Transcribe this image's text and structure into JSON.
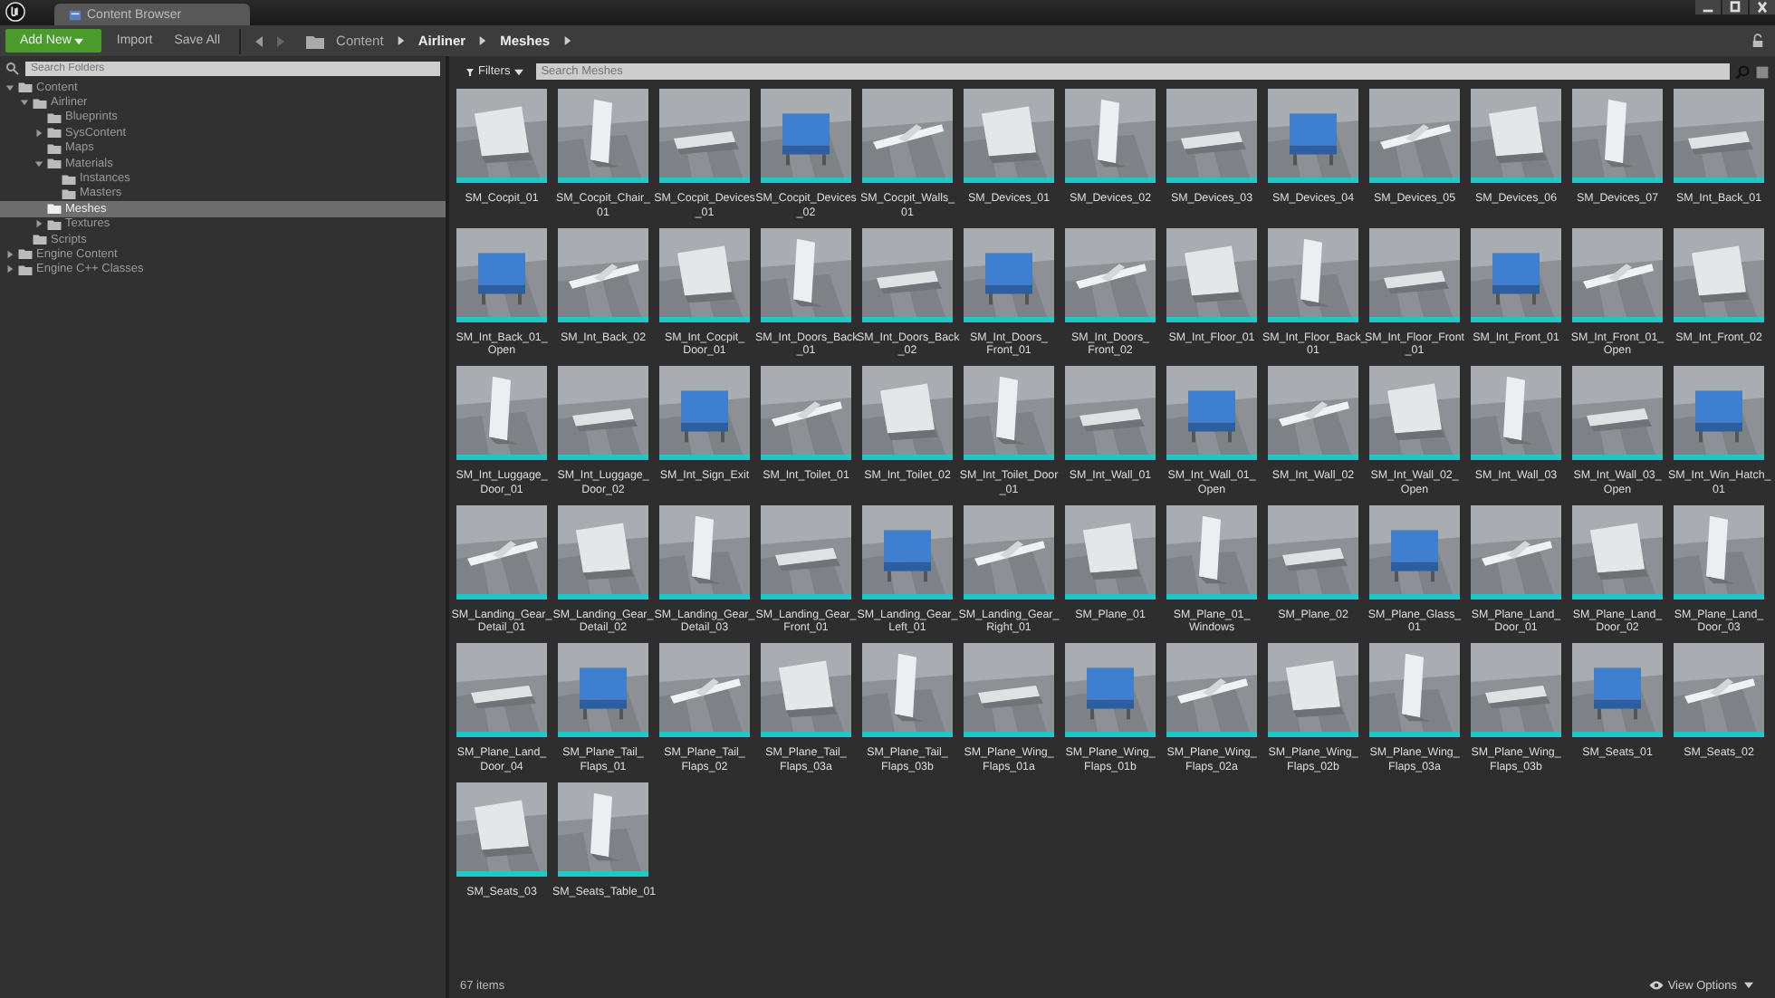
{
  "window": {
    "tab_title": "Content Browser"
  },
  "toolbar": {
    "add_button": "Add New",
    "import_button": "Import",
    "save_button": "Save All"
  },
  "breadcrumb": [
    "Content",
    "Airliner",
    "Meshes"
  ],
  "sidebar": {
    "search": {
      "placeholder": "Search Folders"
    },
    "tree": [
      {
        "label": "Content",
        "selected": false,
        "expanded": true,
        "children": [
          {
            "label": "Airliner",
            "selected": false,
            "expanded": true,
            "children": [
              {
                "label": "Blueprints",
                "selected": false
              },
              {
                "label": "SysContent",
                "selected": false,
                "expanded": false
              },
              {
                "label": "Maps",
                "selected": false
              },
              {
                "label": "Materials",
                "selected": false,
                "expanded": true,
                "children": [
                  {
                    "label": "Instances",
                    "selected": false
                  },
                  {
                    "label": "Masters",
                    "selected": false
                  }
                ]
              },
              {
                "label": "Meshes",
                "selected": true
              },
              {
                "label": "Textures",
                "selected": false,
                "expanded": false
              }
            ]
          },
          {
            "label": "Scripts",
            "selected": false
          }
        ]
      },
      {
        "label": "Engine Content",
        "selected": false,
        "expanded": false
      },
      {
        "label": "Engine C++ Classes",
        "selected": false,
        "expanded": false
      }
    ]
  },
  "filters_button": "Filters",
  "search": {
    "placeholder": "Search Meshes"
  },
  "assets": [
    {
      "name": "SM_Cocpit_01"
    },
    {
      "name": "SM_Cocpit_Chair_\n01"
    },
    {
      "name": "SM_Cocpit_Devices\n_01"
    },
    {
      "name": "SM_Cocpit_Devices\n_02"
    },
    {
      "name": "SM_Cocpit_Walls_\n01"
    },
    {
      "name": "SM_Devices_01"
    },
    {
      "name": "SM_Devices_02"
    },
    {
      "name": "SM_Devices_03"
    },
    {
      "name": "SM_Devices_04"
    },
    {
      "name": "SM_Devices_05"
    },
    {
      "name": "SM_Devices_06"
    },
    {
      "name": "SM_Devices_07"
    },
    {
      "name": "SM_Int_Back_01"
    },
    {
      "name": "SM_Int_Back_01_\nOpen"
    },
    {
      "name": "SM_Int_Back_02"
    },
    {
      "name": "SM_Int_Cocpit_\nDoor_01"
    },
    {
      "name": "SM_Int_Doors_Back\n_01"
    },
    {
      "name": "SM_Int_Doors_Back\n_02"
    },
    {
      "name": "SM_Int_Doors_\nFront_01"
    },
    {
      "name": "SM_Int_Doors_\nFront_02"
    },
    {
      "name": "SM_Int_Floor_01"
    },
    {
      "name": "SM_Int_Floor_Back_\n01"
    },
    {
      "name": "SM_Int_Floor_Front\n_01"
    },
    {
      "name": "SM_Int_Front_01"
    },
    {
      "name": "SM_Int_Front_01_\nOpen"
    },
    {
      "name": "SM_Int_Front_02"
    },
    {
      "name": "SM_Int_Luggage_\nDoor_01"
    },
    {
      "name": "SM_Int_Luggage_\nDoor_02"
    },
    {
      "name": "SM_Int_Sign_Exit"
    },
    {
      "name": "SM_Int_Toilet_01"
    },
    {
      "name": "SM_Int_Toilet_02"
    },
    {
      "name": "SM_Int_Toilet_Door\n_01"
    },
    {
      "name": "SM_Int_Wall_01"
    },
    {
      "name": "SM_Int_Wall_01_\nOpen"
    },
    {
      "name": "SM_Int_Wall_02"
    },
    {
      "name": "SM_Int_Wall_02_\nOpen"
    },
    {
      "name": "SM_Int_Wall_03"
    },
    {
      "name": "SM_Int_Wall_03_\nOpen"
    },
    {
      "name": "SM_Int_Win_Hatch_\n01"
    },
    {
      "name": "SM_Landing_Gear_\nDetail_01"
    },
    {
      "name": "SM_Landing_Gear_\nDetail_02"
    },
    {
      "name": "SM_Landing_Gear_\nDetail_03"
    },
    {
      "name": "SM_Landing_Gear_\nFront_01"
    },
    {
      "name": "SM_Landing_Gear_\nLeft_01"
    },
    {
      "name": "SM_Landing_Gear_\nRight_01"
    },
    {
      "name": "SM_Plane_01"
    },
    {
      "name": "SM_Plane_01_\nWindows"
    },
    {
      "name": "SM_Plane_02"
    },
    {
      "name": "SM_Plane_Glass_\n01"
    },
    {
      "name": "SM_Plane_Land_\nDoor_01"
    },
    {
      "name": "SM_Plane_Land_\nDoor_02"
    },
    {
      "name": "SM_Plane_Land_\nDoor_03"
    },
    {
      "name": "SM_Plane_Land_\nDoor_04"
    },
    {
      "name": "SM_Plane_Tail_\nFlaps_01"
    },
    {
      "name": "SM_Plane_Tail_\nFlaps_02"
    },
    {
      "name": "SM_Plane_Tail_\nFlaps_03a"
    },
    {
      "name": "SM_Plane_Tail_\nFlaps_03b"
    },
    {
      "name": "SM_Plane_Wing_\nFlaps_01a"
    },
    {
      "name": "SM_Plane_Wing_\nFlaps_01b"
    },
    {
      "name": "SM_Plane_Wing_\nFlaps_02a"
    },
    {
      "name": "SM_Plane_Wing_\nFlaps_02b"
    },
    {
      "name": "SM_Plane_Wing_\nFlaps_03a"
    },
    {
      "name": "SM_Plane_Wing_\nFlaps_03b"
    },
    {
      "name": "SM_Seats_01"
    },
    {
      "name": "SM_Seats_02"
    },
    {
      "name": "SM_Seats_03"
    },
    {
      "name": "SM_Seats_Table_01"
    }
  ],
  "status_bar": {
    "count": "67 items",
    "view_options": "View Options"
  }
}
